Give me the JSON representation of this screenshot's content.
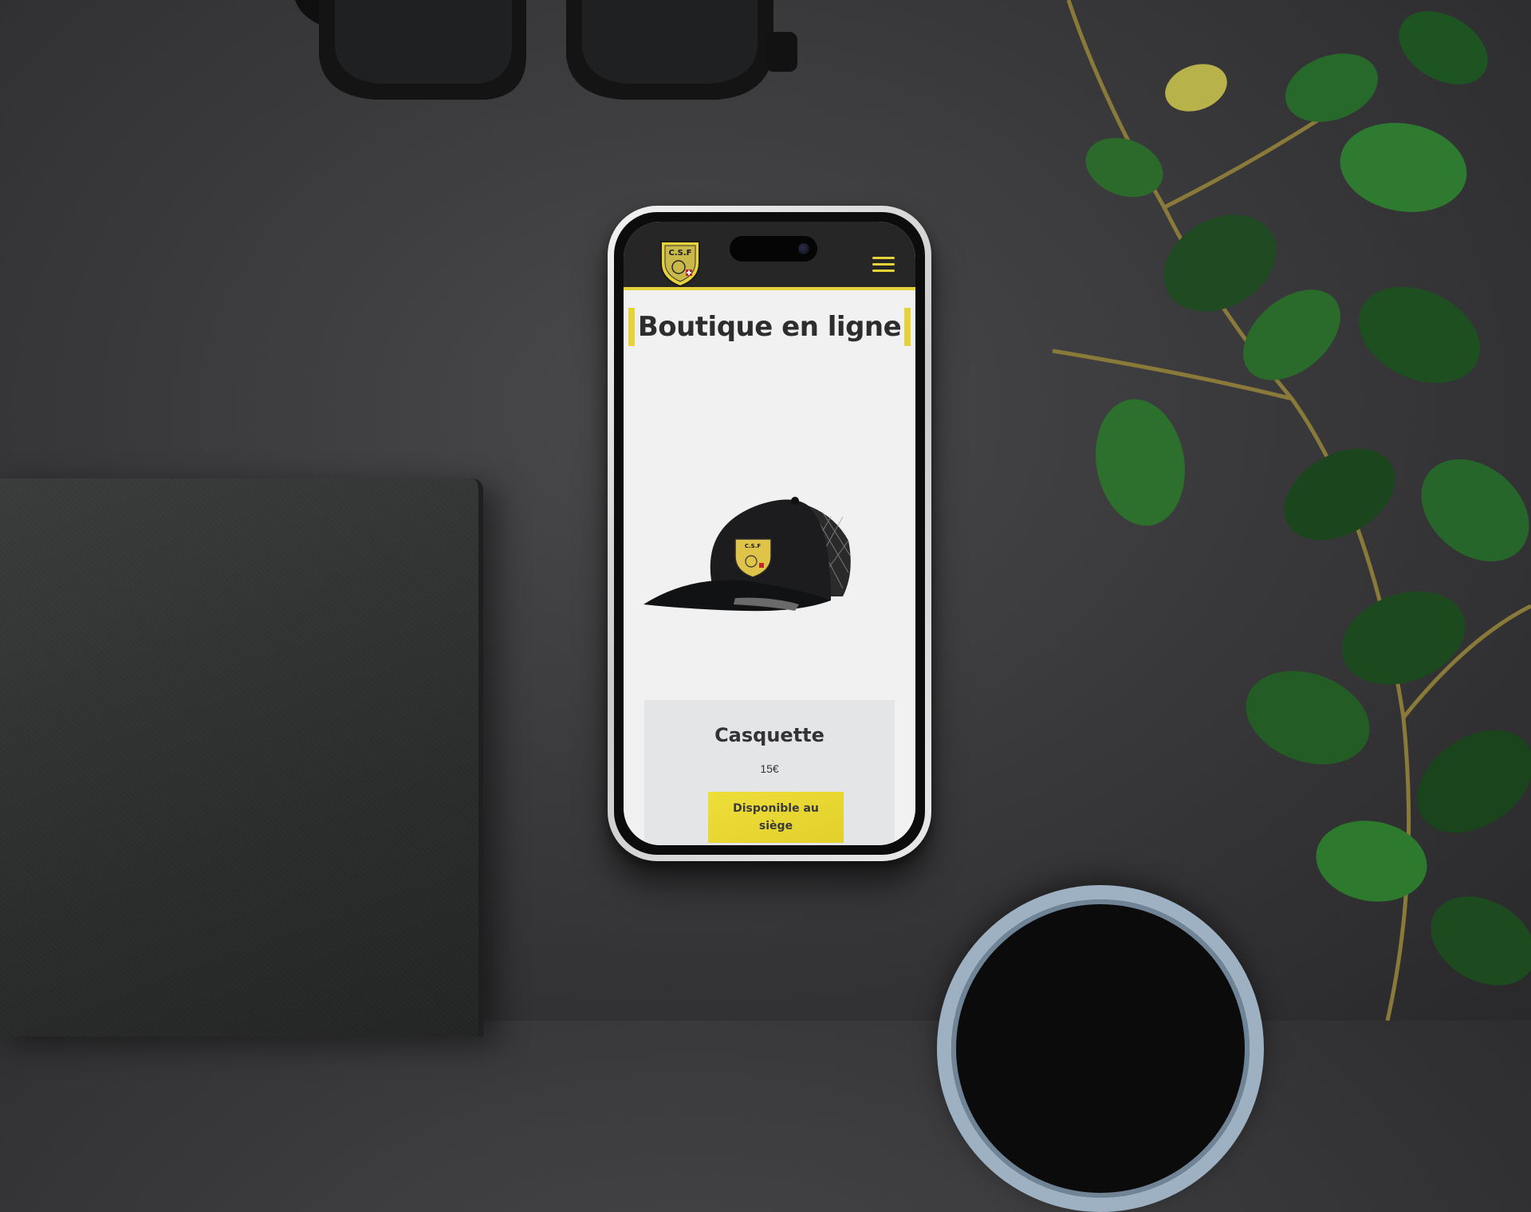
{
  "header": {
    "logo_text": "C.S.F",
    "menu_icon": "hamburger-menu-icon"
  },
  "page": {
    "title": "Boutique en ligne"
  },
  "product": {
    "name": "Casquette",
    "price": "15€",
    "availability_label": "Disponible au siège",
    "image_icon": "cap-icon"
  },
  "colors": {
    "accent": "#e6d23a",
    "topbar": "#262626",
    "card": "#e4e5e7",
    "page_bg": "#f1f1f1"
  }
}
